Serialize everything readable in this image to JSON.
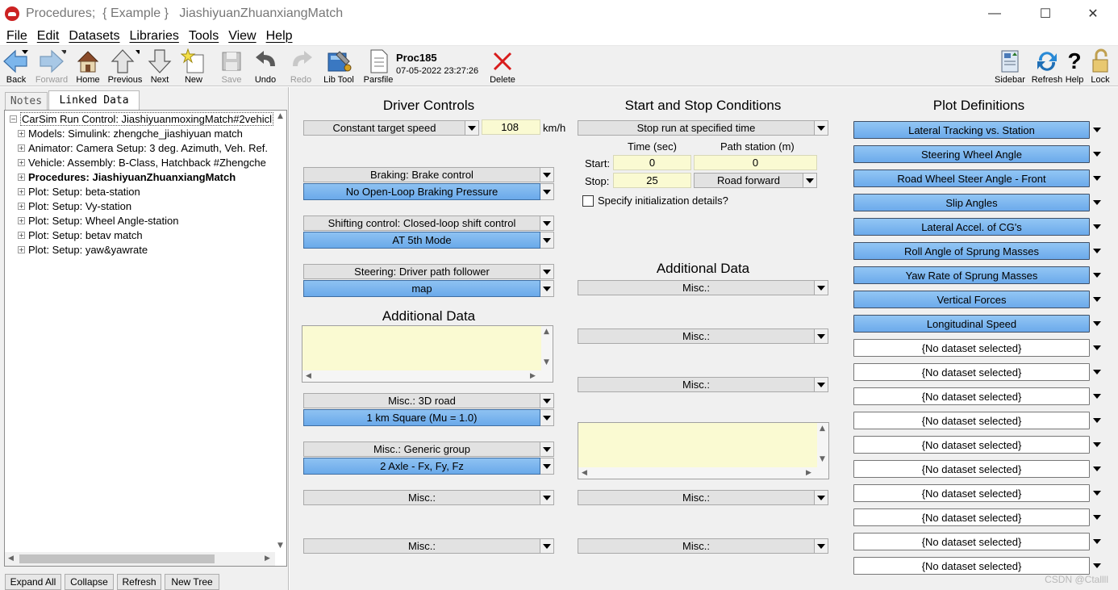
{
  "window": {
    "title": "Procedures;  { Example }   JiashiyuanZhuanxiangMatch",
    "minimize_glyph": "—",
    "maximize_glyph": "☐",
    "close_glyph": "✕"
  },
  "menu": [
    "File",
    "Edit",
    "Datasets",
    "Libraries",
    "Tools",
    "View",
    "Help"
  ],
  "toolbar": {
    "back": "Back",
    "forward": "Forward",
    "home": "Home",
    "previous": "Previous",
    "next": "Next",
    "new": "New",
    "save": "Save",
    "undo": "Undo",
    "redo": "Redo",
    "lib_tool": "Lib Tool",
    "parsfile": "Parsfile",
    "proc_name": "Proc185",
    "proc_date": "07-05-2022 23:27:26",
    "delete": "Delete",
    "sidebar": "Sidebar",
    "refresh": "Refresh",
    "help": "Help",
    "lock": "Lock"
  },
  "left": {
    "tabs": [
      "Notes",
      "Linked Data"
    ],
    "tree": [
      "CarSim Run Control: JiashiyuanmoxingMatch#2vehicl",
      "Models: Simulink: zhengche_jiashiyuan match",
      "Animator: Camera Setup: 3 deg. Azimuth, Veh. Ref.",
      "Vehicle: Assembly: B-Class, Hatchback #Zhengche",
      "Procedures: JiashiyuanZhuanxiangMatch",
      "Plot: Setup: beta-station",
      "Plot: Setup: Vy-station",
      "Plot: Setup: Wheel Angle-station",
      "Plot: Setup: betav match",
      "Plot: Setup: yaw&yawrate"
    ],
    "buttons": [
      "Expand All",
      "Collapse",
      "Refresh",
      "New Tree"
    ]
  },
  "driver": {
    "title": "Driver Controls",
    "speed_mode": "Constant target speed",
    "speed_value": "108",
    "speed_unit": "km/h",
    "braking_label": "Braking: Brake control",
    "braking_value": "No Open-Loop Braking Pressure",
    "shifting_label": "Shifting control: Closed-loop shift control",
    "shifting_value": "AT 5th Mode",
    "steering_label": "Steering: Driver path follower",
    "steering_value": "map",
    "additional_title": "Additional Data",
    "misc1_label": "Misc.: 3D road",
    "misc1_value": "1 km Square (Mu = 1.0)",
    "misc2_label": "Misc.: Generic group",
    "misc2_value": "2 Axle - Fx, Fy, Fz",
    "misc3_label": "Misc.:",
    "misc4_label": "Misc.:"
  },
  "startstop": {
    "title": "Start and Stop Conditions",
    "mode": "Stop run at specified time",
    "time_header": "Time (sec)",
    "station_header": "Path station (m)",
    "start_label": "Start:",
    "stop_label": "Stop:",
    "start_time": "0",
    "start_station": "0",
    "stop_time": "25",
    "direction": "Road forward",
    "init_label": "Specify initialization details?",
    "additional_title": "Additional Data",
    "misc": [
      "Misc.:",
      "Misc.:",
      "Misc.:",
      "Misc.:",
      "Misc.:"
    ]
  },
  "plots": {
    "title": "Plot Definitions",
    "items": [
      "Lateral Tracking vs. Station",
      "Steering Wheel Angle",
      "Road Wheel Steer Angle - Front",
      "Slip Angles",
      "Lateral Accel. of CG's",
      "Roll Angle of Sprung Masses",
      "Yaw Rate of Sprung Masses",
      "Vertical Forces",
      "Longitudinal Speed",
      "{No dataset selected}",
      "{No dataset selected}",
      "{No dataset selected}",
      "{No dataset selected}",
      "{No dataset selected}",
      "{No dataset selected}",
      "{No dataset selected}",
      "{No dataset selected}",
      "{No dataset selected}",
      "{No dataset selected}"
    ]
  },
  "watermark": "CSDN @Ctallll"
}
